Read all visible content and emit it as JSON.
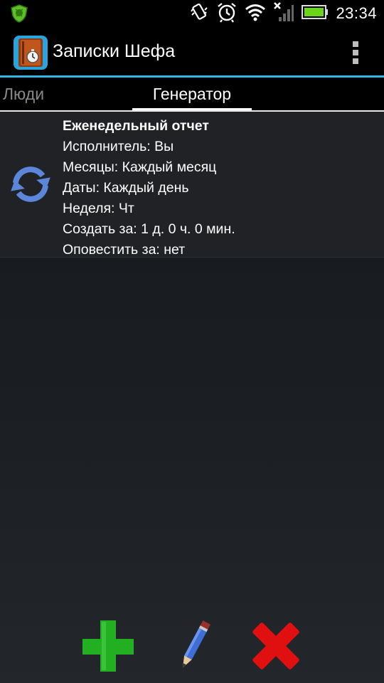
{
  "status_bar": {
    "time": "23:34",
    "icons": [
      "shield-icon",
      "vibrate-icon",
      "alarm-icon",
      "wifi-icon",
      "no-signal-icon",
      "battery-icon"
    ],
    "battery_color": "#6bd619"
  },
  "app": {
    "title": "Записки Шефа",
    "accent_color": "#33b5e5"
  },
  "tabs": [
    {
      "label": "Люди",
      "selected": false
    },
    {
      "label": "Генератор",
      "selected": true
    }
  ],
  "items": [
    {
      "icon": "repeat-icon",
      "title": "Еженедельный отчет",
      "lines": [
        "Исполнитель:  Вы",
        "Месяцы: Каждый месяц",
        "Даты: Каждый день",
        "Неделя: Чт",
        "Создать за: 1 д. 0 ч. 0 мин.",
        "Оповестить за: нет"
      ]
    }
  ],
  "toolbar": {
    "buttons": [
      "add-icon",
      "pencil-icon",
      "delete-icon"
    ],
    "colors": {
      "add": "#22b022",
      "delete": "#e01010",
      "edit": "#3d6fd6"
    }
  }
}
